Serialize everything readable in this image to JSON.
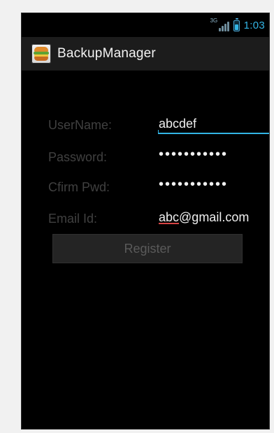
{
  "status_bar": {
    "network_label": "3G",
    "time": "1:03"
  },
  "action_bar": {
    "title": "BackupManager"
  },
  "form": {
    "username": {
      "label": "UserName:",
      "value": "abcdef"
    },
    "password": {
      "label": "Password:",
      "value": "•••••••••••"
    },
    "confirm_password": {
      "label": "Cfirm Pwd:",
      "value": "•••••••••••"
    },
    "email": {
      "label": "Email Id:",
      "value_prefix": "abc",
      "value_suffix": "@gmail.com"
    },
    "register_label": "Register"
  },
  "colors": {
    "accent": "#33b5e5",
    "screen_background": "#000000",
    "action_bar_background": "#1c1c1c",
    "label_text": "#404040",
    "value_text": "#efefef",
    "button_background": "#242424",
    "spellcheck_underline": "#d64545"
  },
  "icons": {
    "app_icon": "burger-app-icon",
    "signal": "signal-icon",
    "battery": "battery-icon"
  }
}
